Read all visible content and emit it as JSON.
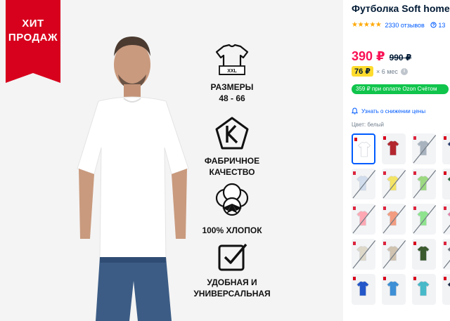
{
  "gallery": {
    "badge_line1": "ХИТ",
    "badge_line2": "ПРОДАЖ",
    "size_chart_label": "XXL",
    "features": [
      {
        "line1": "РАЗМЕРЫ",
        "line2": "48 - 66",
        "icon": "tshirt-size-icon"
      },
      {
        "line1": "ФАБРИЧНОЕ",
        "line2": "КАЧЕСТВО",
        "icon": "quality-k-icon"
      },
      {
        "line1": "100%  ХЛОПОК",
        "line2": "",
        "icon": "cotton-flower-icon"
      },
      {
        "line1": "УДОБНАЯ И",
        "line2": "УНИВЕРСАЛЬНАЯ",
        "icon": "checkbox-icon"
      }
    ]
  },
  "product": {
    "title": "Футболка Soft home",
    "stars": "★★★★★",
    "reviews": "2330 отзывов",
    "qa_count": "13",
    "price": "390 ₽",
    "old_price": "990 ₽",
    "installment_amount": "76 ₽",
    "installment_term": "× 6 мес",
    "card_offer": "359 ₽ при оплате Ozon Счётом",
    "notify_text": "Узнать о снижении цены",
    "color_label": "Цвет: белый"
  },
  "colors": {
    "accent": "#005bff",
    "price": "#f91155",
    "badge": "#d7001d",
    "card_offer": "#10c44c",
    "installment": "#ffdc2e"
  },
  "swatches": [
    {
      "color": "#ffffff",
      "selected": true,
      "available": true
    },
    {
      "color": "#b3262e",
      "selected": false,
      "available": true
    },
    {
      "color": "#9aa6b4",
      "selected": false,
      "available": false
    },
    {
      "color": "#2a3e6e",
      "selected": false,
      "available": true
    },
    {
      "color": "#c9d8ea",
      "selected": false,
      "available": false
    },
    {
      "color": "#f3e04a",
      "selected": false,
      "available": false
    },
    {
      "color": "#8bd36b",
      "selected": false,
      "available": false
    },
    {
      "color": "#2c6b3a",
      "selected": false,
      "available": true
    },
    {
      "color": "#ff9aa8",
      "selected": false,
      "available": false
    },
    {
      "color": "#f28b6b",
      "selected": false,
      "available": false
    },
    {
      "color": "#7be07b",
      "selected": false,
      "available": false
    },
    {
      "color": "#e06a9c",
      "selected": false,
      "available": false
    },
    {
      "color": "#d9d2c0",
      "selected": false,
      "available": false
    },
    {
      "color": "#c8b9a2",
      "selected": false,
      "available": false
    },
    {
      "color": "#3b5a2e",
      "selected": false,
      "available": true
    },
    {
      "color": "#555c66",
      "selected": false,
      "available": false
    },
    {
      "color": "#2356c9",
      "selected": false,
      "available": true
    },
    {
      "color": "#3d8fd6",
      "selected": false,
      "available": true
    },
    {
      "color": "#47b9c9",
      "selected": false,
      "available": true
    },
    {
      "color": "#1f2a44",
      "selected": false,
      "available": true
    }
  ]
}
